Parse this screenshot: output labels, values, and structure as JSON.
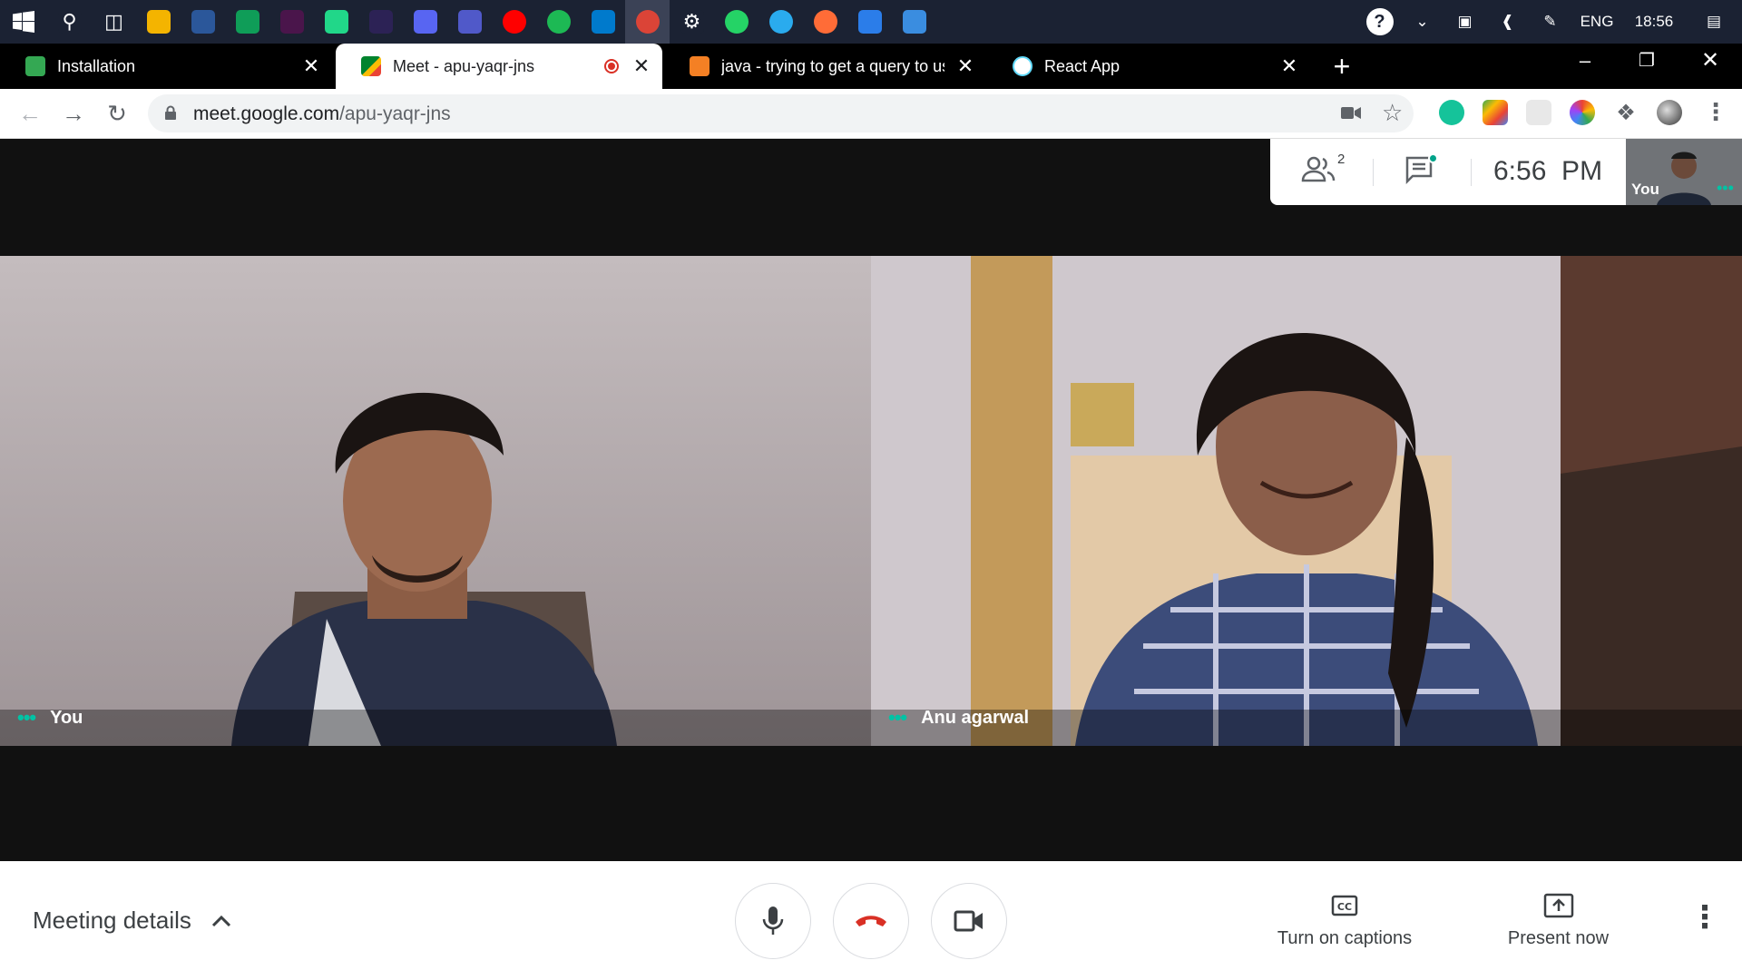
{
  "taskbar": {
    "apps": [
      {
        "icon": "search-icon",
        "color": "#1b2233"
      },
      {
        "icon": "task-view-icon",
        "color": "#1b2233"
      },
      {
        "icon": "file-explorer-icon",
        "color": "#f4b400"
      },
      {
        "icon": "word-icon",
        "color": "#2b579a"
      },
      {
        "icon": "sync-app-icon",
        "color": "#0f9d58"
      },
      {
        "icon": "slack-icon",
        "color": "#4a154b"
      },
      {
        "icon": "pycharm-icon",
        "color": "#21d789"
      },
      {
        "icon": "eclipse-icon",
        "color": "#2c2255"
      },
      {
        "icon": "discord-icon",
        "color": "#5865f2"
      },
      {
        "icon": "teams-icon",
        "color": "#5059c9"
      },
      {
        "icon": "youtube-music-icon",
        "color": "#ff0000"
      },
      {
        "icon": "spotify-icon",
        "color": "#1db954"
      },
      {
        "icon": "vscode-icon",
        "color": "#007acc"
      },
      {
        "icon": "chrome-icon",
        "color": "#db4437"
      },
      {
        "icon": "settings-gear-icon",
        "color": "#1b2233"
      },
      {
        "icon": "whatsapp-icon",
        "color": "#25d366"
      },
      {
        "icon": "telegram-icon",
        "color": "#2aabee"
      },
      {
        "icon": "postman-icon",
        "color": "#ff6c37"
      },
      {
        "icon": "wps-writer-icon",
        "color": "#2b7de9"
      },
      {
        "icon": "redirect-app-icon",
        "color": "#3a8de0"
      }
    ],
    "language": "ENG",
    "clock": "18:56"
  },
  "tabs": [
    {
      "title": "Installation",
      "favicon_color": "#34a853",
      "active": false
    },
    {
      "title": "Meet - apu-yaqr-jns",
      "favicon_color": "#00897b",
      "active": true,
      "recording": true
    },
    {
      "title": "java - trying to get a query to use",
      "favicon_color": "#f48024",
      "active": false
    },
    {
      "title": "React App",
      "favicon_color": "#61dafb",
      "active": false
    }
  ],
  "address": {
    "domain": "meet.google.com",
    "path": "/apu-yaqr-jns"
  },
  "meet": {
    "participant_count": "2",
    "time": "6:56  PM",
    "self_label": "You",
    "tiles": [
      {
        "name": "You"
      },
      {
        "name": "Anu agarwal"
      }
    ]
  },
  "controls": {
    "meeting_details": "Meeting details",
    "captions": "Turn on captions",
    "present": "Present now"
  }
}
